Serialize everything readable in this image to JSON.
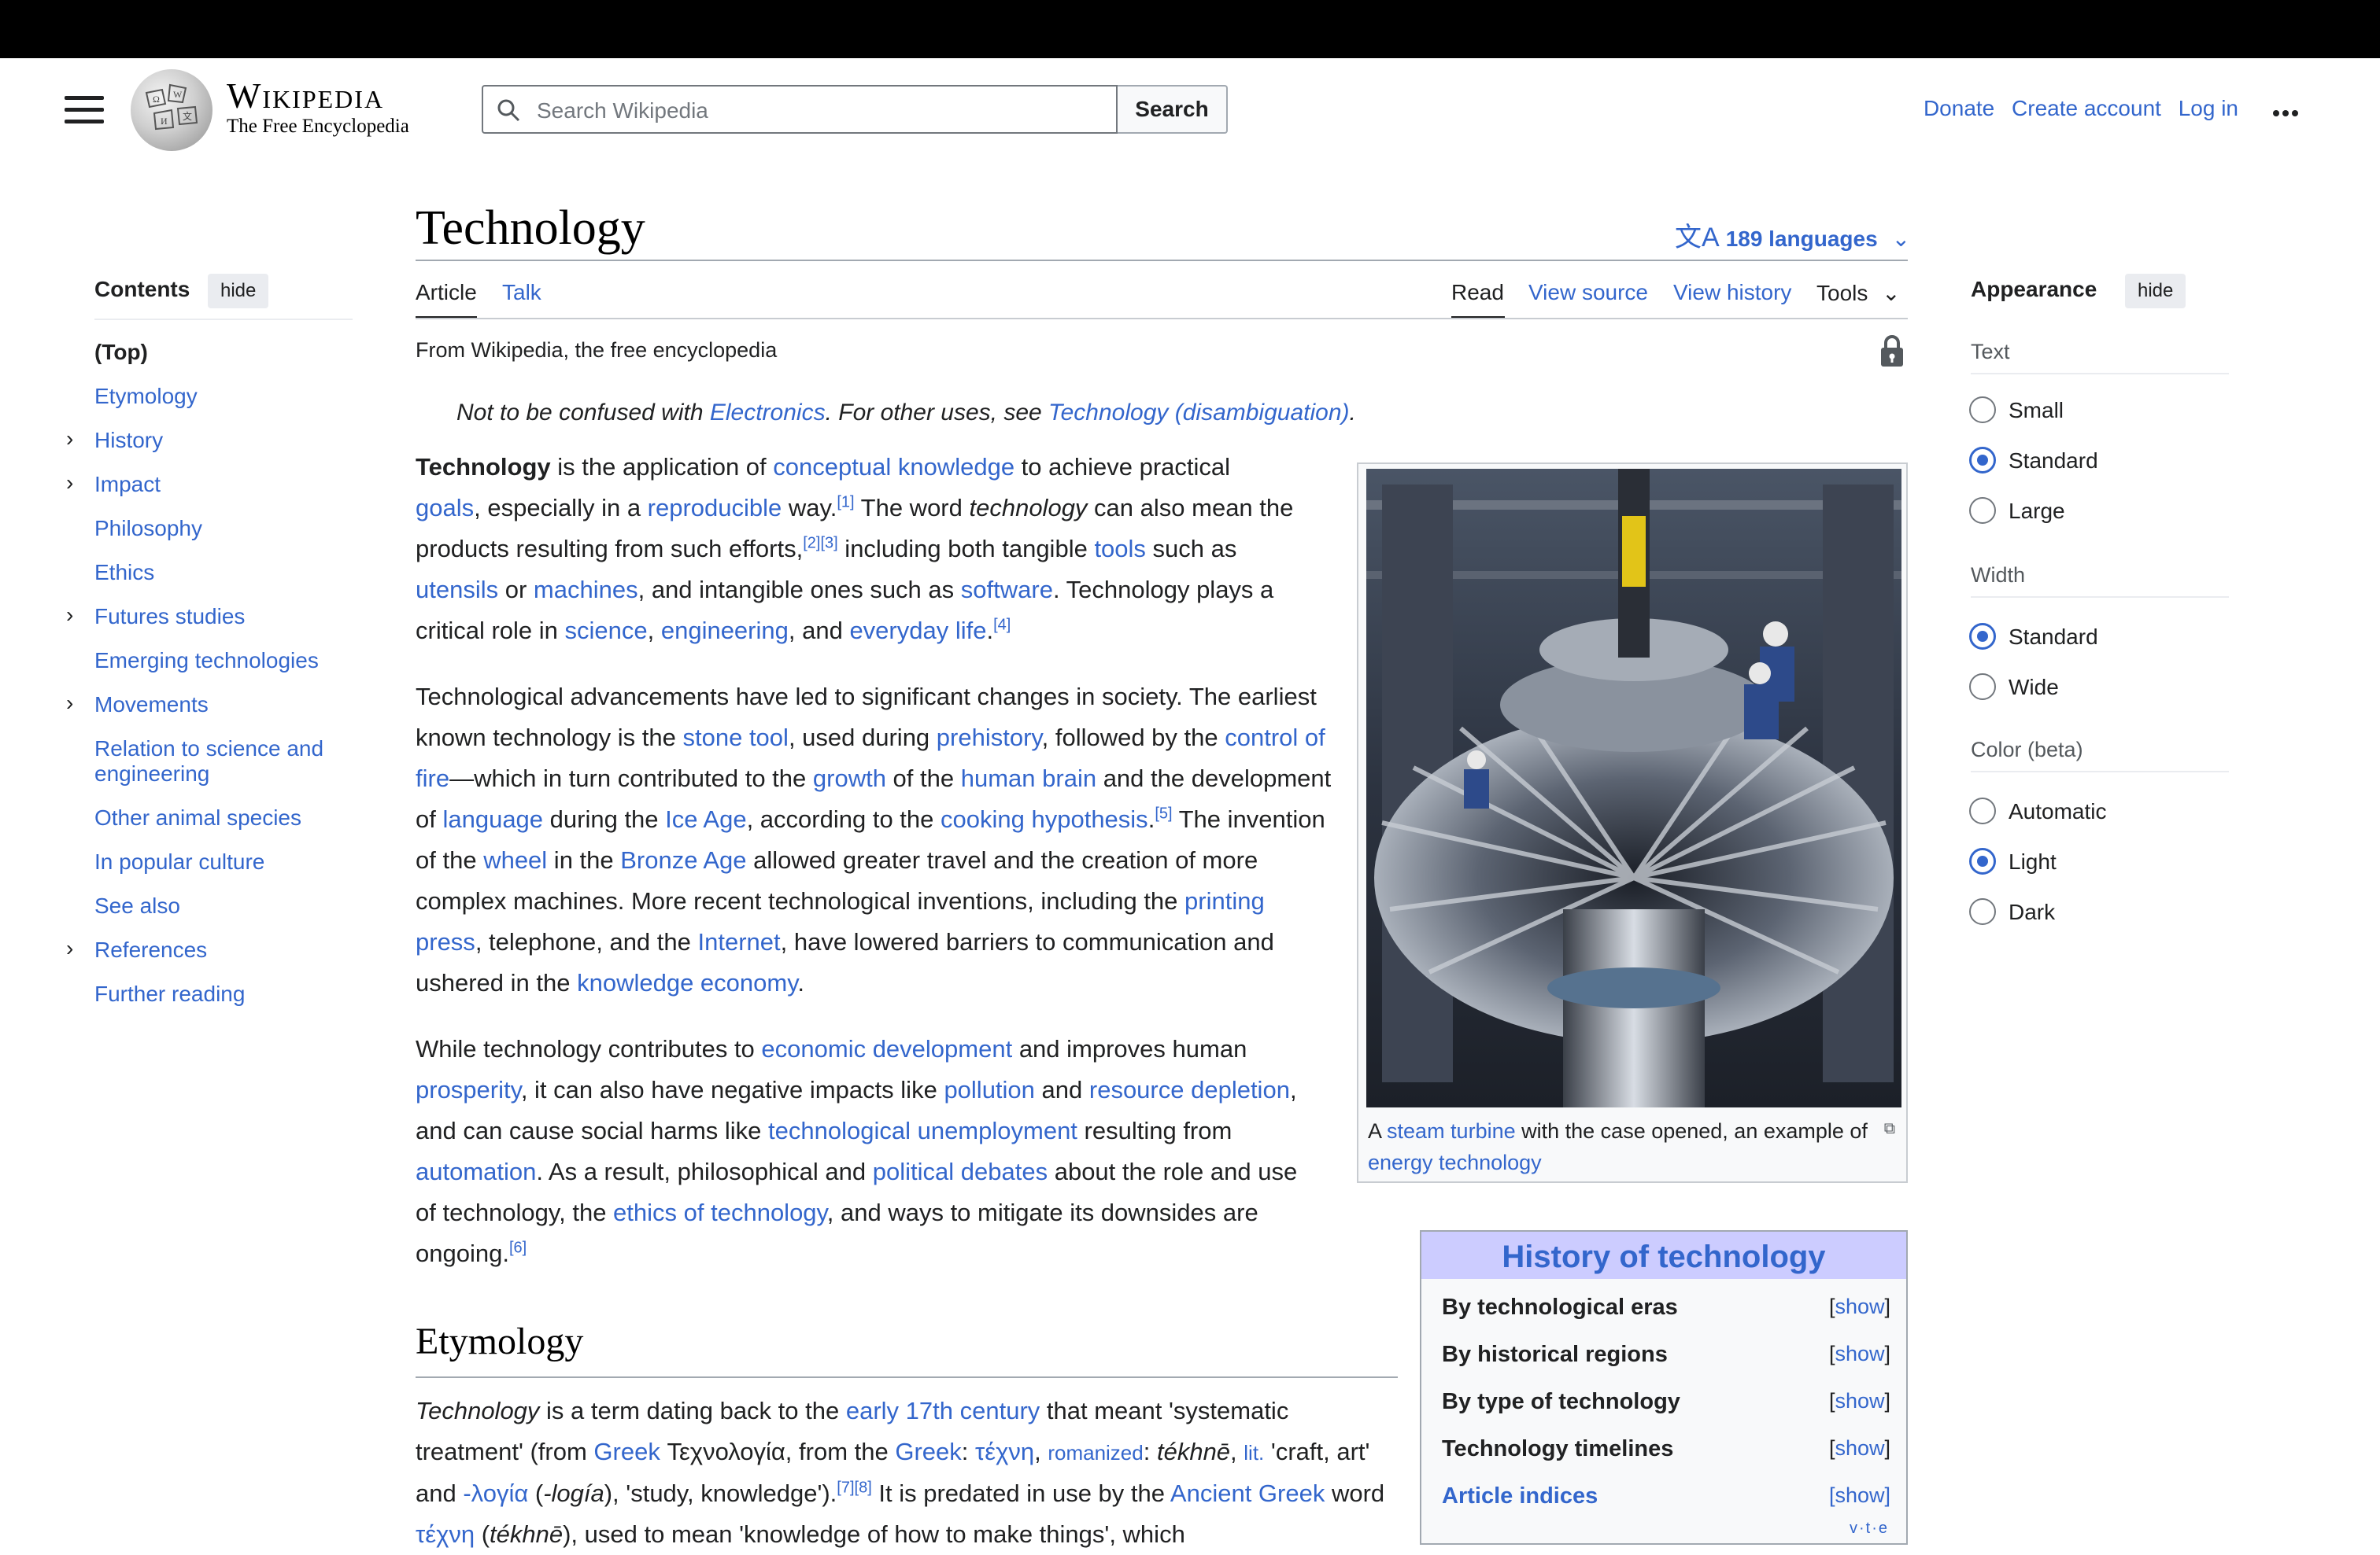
{
  "header": {
    "wordmark": "Wikipedia",
    "tagline": "The Free Encyclopedia",
    "search_placeholder": "Search Wikipedia",
    "search_button": "Search",
    "donate": "Donate",
    "create_account": "Create account",
    "log_in": "Log in"
  },
  "article": {
    "title": "Technology",
    "languages": "189 languages",
    "tabs": {
      "article": "Article",
      "talk": "Talk",
      "read": "Read",
      "view_source": "View source",
      "view_history": "View history",
      "tools": "Tools"
    },
    "from": "From Wikipedia, the free encyclopedia",
    "hatnote": {
      "p1": "Not to be confused with ",
      "l1": "Electronics",
      "p2": ". For other uses, see ",
      "l2": "Technology (disambiguation)",
      "p3": "."
    },
    "etymology_heading": "Etymology"
  },
  "toc": {
    "heading": "Contents",
    "hide": "hide",
    "items": [
      {
        "label": "(Top)",
        "expandable": false
      },
      {
        "label": "Etymology",
        "expandable": false
      },
      {
        "label": "History",
        "expandable": true
      },
      {
        "label": "Impact",
        "expandable": true
      },
      {
        "label": "Philosophy",
        "expandable": false
      },
      {
        "label": "Ethics",
        "expandable": false
      },
      {
        "label": "Futures studies",
        "expandable": true
      },
      {
        "label": "Emerging technologies",
        "expandable": false
      },
      {
        "label": "Movements",
        "expandable": true
      },
      {
        "label": "Relation to science and engineering",
        "expandable": false
      },
      {
        "label": "Other animal species",
        "expandable": false
      },
      {
        "label": "In popular culture",
        "expandable": false
      },
      {
        "label": "See also",
        "expandable": false
      },
      {
        "label": "References",
        "expandable": true
      },
      {
        "label": "Further reading",
        "expandable": false
      }
    ]
  },
  "appearance": {
    "heading": "Appearance",
    "hide": "hide",
    "text_label": "Text",
    "text_options": [
      "Small",
      "Standard",
      "Large"
    ],
    "text_selected": "Standard",
    "width_label": "Width",
    "width_options": [
      "Standard",
      "Wide"
    ],
    "width_selected": "Standard",
    "color_label": "Color (beta)",
    "color_options": [
      "Automatic",
      "Light",
      "Dark"
    ],
    "color_selected": "Light"
  },
  "figure": {
    "cap_a": "A ",
    "cap_link1": "steam turbine",
    "cap_mid": " with the case opened, an example of ",
    "cap_link2": "energy technology"
  },
  "navbox": {
    "title": "History of technology",
    "show": "show",
    "rows": [
      "By technological eras",
      "By historical regions",
      "By type of technology",
      "Technology timelines",
      "Article indices"
    ],
    "vte": "v·t·e"
  },
  "paragraphs": [
    [
      {
        "t": "Technology",
        "b": true
      },
      {
        "t": " is the application of "
      },
      {
        "t": "conceptual knowledge",
        "l": true
      },
      {
        "t": " to achieve practical "
      },
      {
        "t": "goals",
        "l": true
      },
      {
        "t": ", especially in a "
      },
      {
        "t": "reproducible",
        "l": true
      },
      {
        "t": " way."
      },
      {
        "t": "[1]",
        "s": true
      },
      {
        "t": " The word "
      },
      {
        "t": "technology",
        "i": true
      },
      {
        "t": " can also mean the products resulting from such efforts,"
      },
      {
        "t": "[2][3]",
        "s": true
      },
      {
        "t": " including both tangible "
      },
      {
        "t": "tools",
        "l": true
      },
      {
        "t": " such as "
      },
      {
        "t": "utensils",
        "l": true
      },
      {
        "t": " or "
      },
      {
        "t": "machines",
        "l": true
      },
      {
        "t": ", and intangible ones such as "
      },
      {
        "t": "software",
        "l": true
      },
      {
        "t": ". Technology plays a critical role in "
      },
      {
        "t": "science",
        "l": true
      },
      {
        "t": ", "
      },
      {
        "t": "engineering",
        "l": true
      },
      {
        "t": ", and "
      },
      {
        "t": "everyday life",
        "l": true
      },
      {
        "t": "."
      },
      {
        "t": "[4]",
        "s": true
      }
    ],
    [
      {
        "t": "Technological advancements have led to significant changes in society. The earliest known technology is the "
      },
      {
        "t": "stone tool",
        "l": true
      },
      {
        "t": ", used during "
      },
      {
        "t": "prehistory",
        "l": true
      },
      {
        "t": ", followed by the "
      },
      {
        "t": "control of fire",
        "l": true
      },
      {
        "t": "—which in turn contributed to the "
      },
      {
        "t": "growth",
        "l": true
      },
      {
        "t": " of the "
      },
      {
        "t": "human brain",
        "l": true
      },
      {
        "t": " and the development of "
      },
      {
        "t": "language",
        "l": true
      },
      {
        "t": " during the "
      },
      {
        "t": "Ice Age",
        "l": true
      },
      {
        "t": ", according to the "
      },
      {
        "t": "cooking hypothesis",
        "l": true
      },
      {
        "t": "."
      },
      {
        "t": "[5]",
        "s": true
      },
      {
        "t": " The invention of the "
      },
      {
        "t": "wheel",
        "l": true
      },
      {
        "t": " in the "
      },
      {
        "t": "Bronze Age",
        "l": true
      },
      {
        "t": " allowed greater travel and the creation of more complex machines. More recent technological inventions, including the "
      },
      {
        "t": "printing press",
        "l": true
      },
      {
        "t": ", telephone, and the "
      },
      {
        "t": "Internet",
        "l": true
      },
      {
        "t": ", have lowered barriers to communication and ushered in the "
      },
      {
        "t": "knowledge economy",
        "l": true
      },
      {
        "t": "."
      }
    ],
    [
      {
        "t": "While technology contributes to "
      },
      {
        "t": "economic development",
        "l": true
      },
      {
        "t": " and improves human "
      },
      {
        "t": "prosperity",
        "l": true
      },
      {
        "t": ", it can also have negative impacts like "
      },
      {
        "t": "pollution",
        "l": true
      },
      {
        "t": " and "
      },
      {
        "t": "resource depletion",
        "l": true
      },
      {
        "t": ", and can cause social harms like "
      },
      {
        "t": "technological unemployment",
        "l": true
      },
      {
        "t": " resulting from "
      },
      {
        "t": "automation",
        "l": true
      },
      {
        "t": ". As a result, philosophical and "
      },
      {
        "t": "political debates",
        "l": true
      },
      {
        "t": " about the role and use of technology, the "
      },
      {
        "t": "ethics of technology",
        "l": true
      },
      {
        "t": ", and ways to mitigate its downsides are ongoing."
      },
      {
        "t": "[6]",
        "s": true
      }
    ],
    [
      {
        "t": "Technology",
        "i": true
      },
      {
        "t": " is a term dating back to the "
      },
      {
        "t": "early 17th century",
        "l": true
      },
      {
        "t": " that meant 'systematic treatment' (from "
      },
      {
        "t": "Greek",
        "l": true
      },
      {
        "t": " Τεχνολογία, from the "
      },
      {
        "t": "Greek",
        "l": true
      },
      {
        "t": ": "
      },
      {
        "t": "τέχνη",
        "l": true
      },
      {
        "t": ", "
      },
      {
        "t": "romanized",
        "l": true,
        "sm": true
      },
      {
        "t": ": "
      },
      {
        "t": "tékhnē",
        "i": true
      },
      {
        "t": ", "
      },
      {
        "t": "lit.",
        "l": true,
        "sm": true
      },
      {
        "t": " 'craft, art' and "
      },
      {
        "t": "-λογία",
        "l": true
      },
      {
        "t": " ("
      },
      {
        "t": "-logía",
        "i": true
      },
      {
        "t": "), 'study, knowledge')."
      },
      {
        "t": "[7][8]",
        "s": true
      },
      {
        "t": " It is predated in use by the "
      },
      {
        "t": "Ancient Greek",
        "l": true
      },
      {
        "t": " word "
      },
      {
        "t": "τέχνη",
        "l": true
      },
      {
        "t": " ("
      },
      {
        "t": "tékhnē",
        "i": true
      },
      {
        "t": "), used to mean 'knowledge of how to make things', which"
      }
    ]
  ]
}
